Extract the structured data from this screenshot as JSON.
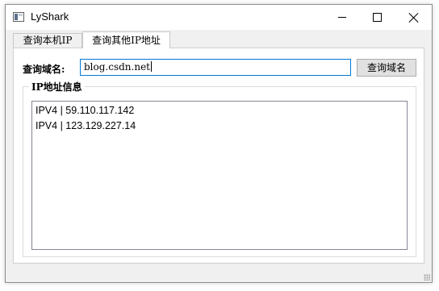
{
  "window": {
    "title": "LyShark",
    "icon": "app-window-icon"
  },
  "titlebar_controls": {
    "minimize": "minimize-icon",
    "maximize": "maximize-icon",
    "close": "close-icon"
  },
  "tabs": [
    {
      "label": "查询本机IP",
      "active": false
    },
    {
      "label": "查询其他IP地址",
      "active": true
    }
  ],
  "form": {
    "domain_label": "查询域名:",
    "domain_value": "blog.csdn.net",
    "query_button": "查询域名"
  },
  "group": {
    "title": "IP地址信息",
    "results": [
      "IPV4 | 59.110.117.142",
      "IPV4 | 123.129.227.14"
    ]
  },
  "colors": {
    "input_focus_border": "#0078d7",
    "window_background": "#f0f0f0",
    "panel_background": "#ffffff"
  }
}
